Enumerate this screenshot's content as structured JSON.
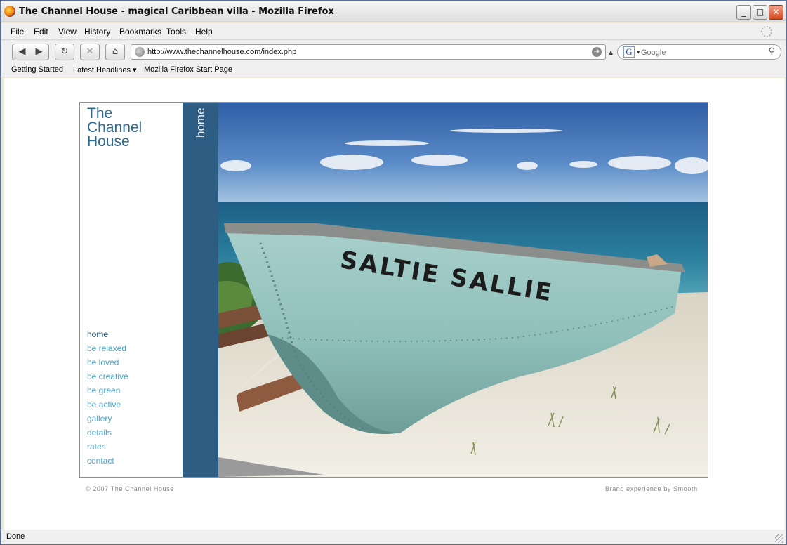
{
  "window": {
    "title": "The Channel House - magical Caribbean villa - Mozilla Firefox",
    "controls": {
      "minimize": "_",
      "maximize": "□",
      "close": "✕"
    }
  },
  "menu": {
    "items": [
      "File",
      "Edit",
      "View",
      "History",
      "Bookmarks",
      "Tools",
      "Help"
    ]
  },
  "toolbar": {
    "back": "◀",
    "forward": "▶",
    "reload": "↻",
    "stop": "✕",
    "home": "⌂",
    "url": "http://www.thechannelhouse.com/index.php",
    "go": "➔",
    "search_engine_icon": "G",
    "search_placeholder": "Google",
    "search_icon": "⚲"
  },
  "bookmarks": {
    "items": [
      "Getting Started",
      "Latest Headlines ▾",
      "Mozilla Firefox Start Page"
    ]
  },
  "site": {
    "logo": [
      "The",
      "Channel",
      "House"
    ],
    "section_label": "home",
    "nav": [
      {
        "label": "home",
        "active": true
      },
      {
        "label": "be relaxed",
        "active": false
      },
      {
        "label": "be loved",
        "active": false
      },
      {
        "label": "be creative",
        "active": false
      },
      {
        "label": "be green",
        "active": false
      },
      {
        "label": "be active",
        "active": false
      },
      {
        "label": "gallery",
        "active": false
      },
      {
        "label": "details",
        "active": false
      },
      {
        "label": "rates",
        "active": false
      },
      {
        "label": "contact",
        "active": false
      }
    ],
    "photo_boat_name": "SALTIE SALLIE",
    "footer_left": "© 2007 The Channel House",
    "footer_right": "Brand experience by Smooth",
    "colors": {
      "logo": "#2d6891",
      "nav_link": "#4da2c4",
      "nav_active": "#1e4d6e",
      "side_strip": "#2e5d84"
    }
  },
  "status": {
    "text": "Done"
  }
}
